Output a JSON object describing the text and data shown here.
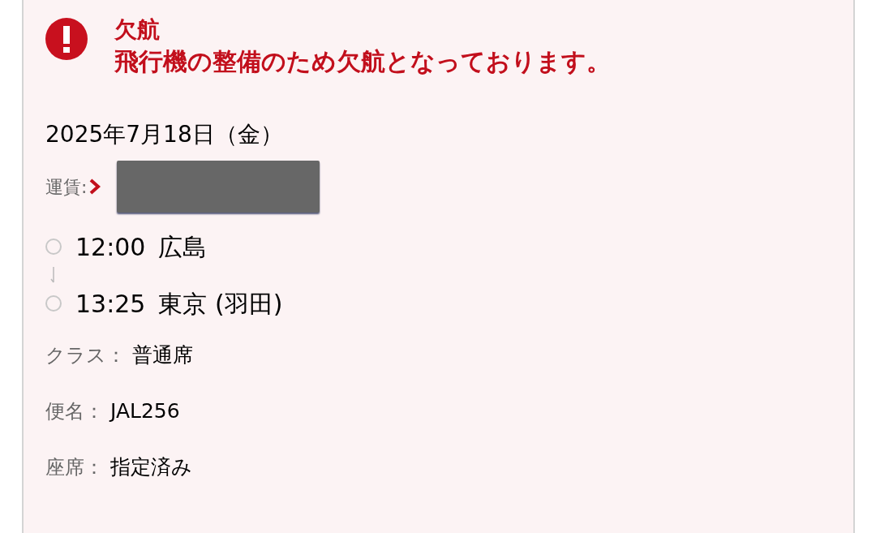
{
  "alert": {
    "title": "欠航",
    "message": "飛行機の整備のため欠航となっております。"
  },
  "date": "2025年7月18日（金）",
  "fare": {
    "label": "運賃:"
  },
  "itinerary": [
    {
      "time": "12:00",
      "place": "広島"
    },
    {
      "time": "13:25",
      "place": "東京 (羽田)"
    }
  ],
  "details": [
    {
      "label": "クラス：",
      "value": "普通席"
    },
    {
      "label": "便名：",
      "value": "JAL256"
    },
    {
      "label": "座席：",
      "value": "指定済み"
    }
  ]
}
